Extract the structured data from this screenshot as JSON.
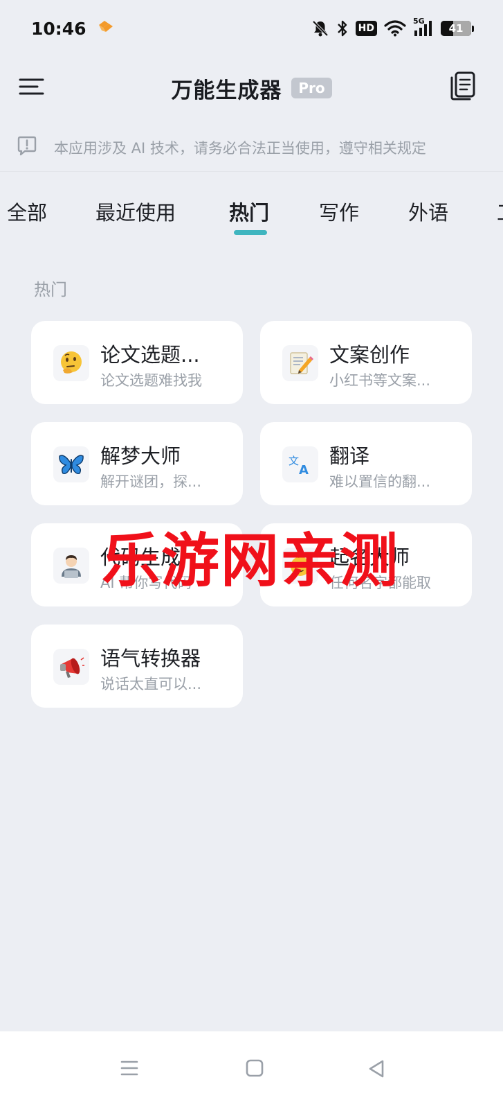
{
  "status_bar": {
    "time": "10:46",
    "hd_label": "HD",
    "network_label": "5G",
    "battery": "41",
    "icons": [
      "app-logo-icon",
      "mute-bell-icon",
      "bluetooth-icon",
      "hd-icon",
      "wifi-icon",
      "signal-5g-icon",
      "battery-icon"
    ]
  },
  "header": {
    "title": "万能生成器",
    "badge": "Pro",
    "icons": [
      "menu-icon",
      "document-list-icon"
    ]
  },
  "notice": {
    "text": "本应用涉及 AI 技术，请务必合法正当使用，遵守相关规定",
    "icon": "info-message-icon"
  },
  "tabs": [
    {
      "label": "全部",
      "active": false
    },
    {
      "label": "最近使用",
      "active": false
    },
    {
      "label": "热门",
      "active": true
    },
    {
      "label": "写作",
      "active": false
    },
    {
      "label": "外语",
      "active": false
    },
    {
      "label": "工",
      "active": false
    }
  ],
  "section": {
    "title": "热门"
  },
  "cards": [
    {
      "title": "论文选题...",
      "subtitle": "论文选题难找我",
      "icon": "thinking-face-icon",
      "emoji": "🤔"
    },
    {
      "title": "文案创作",
      "subtitle": "小红书等文案...",
      "icon": "memo-pencil-icon",
      "emoji": "📝"
    },
    {
      "title": "解梦大师",
      "subtitle": "解开谜团，探...",
      "icon": "butterfly-icon",
      "emoji": "🦋"
    },
    {
      "title": "翻译",
      "subtitle": "难以置信的翻...",
      "icon": "translate-icon",
      "emoji": "文A"
    },
    {
      "title": "代码生成",
      "subtitle": "AI 帮你写代码",
      "icon": "technologist-icon",
      "emoji": "👨‍💻"
    },
    {
      "title": "起名大师",
      "subtitle": "任何名字都能取",
      "icon": "baby-face-icon",
      "emoji": "👶"
    },
    {
      "title": "语气转换器",
      "subtitle": "说话太直可以...",
      "icon": "megaphone-icon",
      "emoji": "📣"
    }
  ],
  "watermark": {
    "text": "乐游网亲测"
  },
  "nav_bar": {
    "icons": [
      "recents-icon",
      "home-icon",
      "back-icon"
    ]
  },
  "colors": {
    "background": "#eceef3",
    "accent": "#3fb5bf",
    "watermark": "#f0101a",
    "muted_text": "#9aa0a8"
  }
}
